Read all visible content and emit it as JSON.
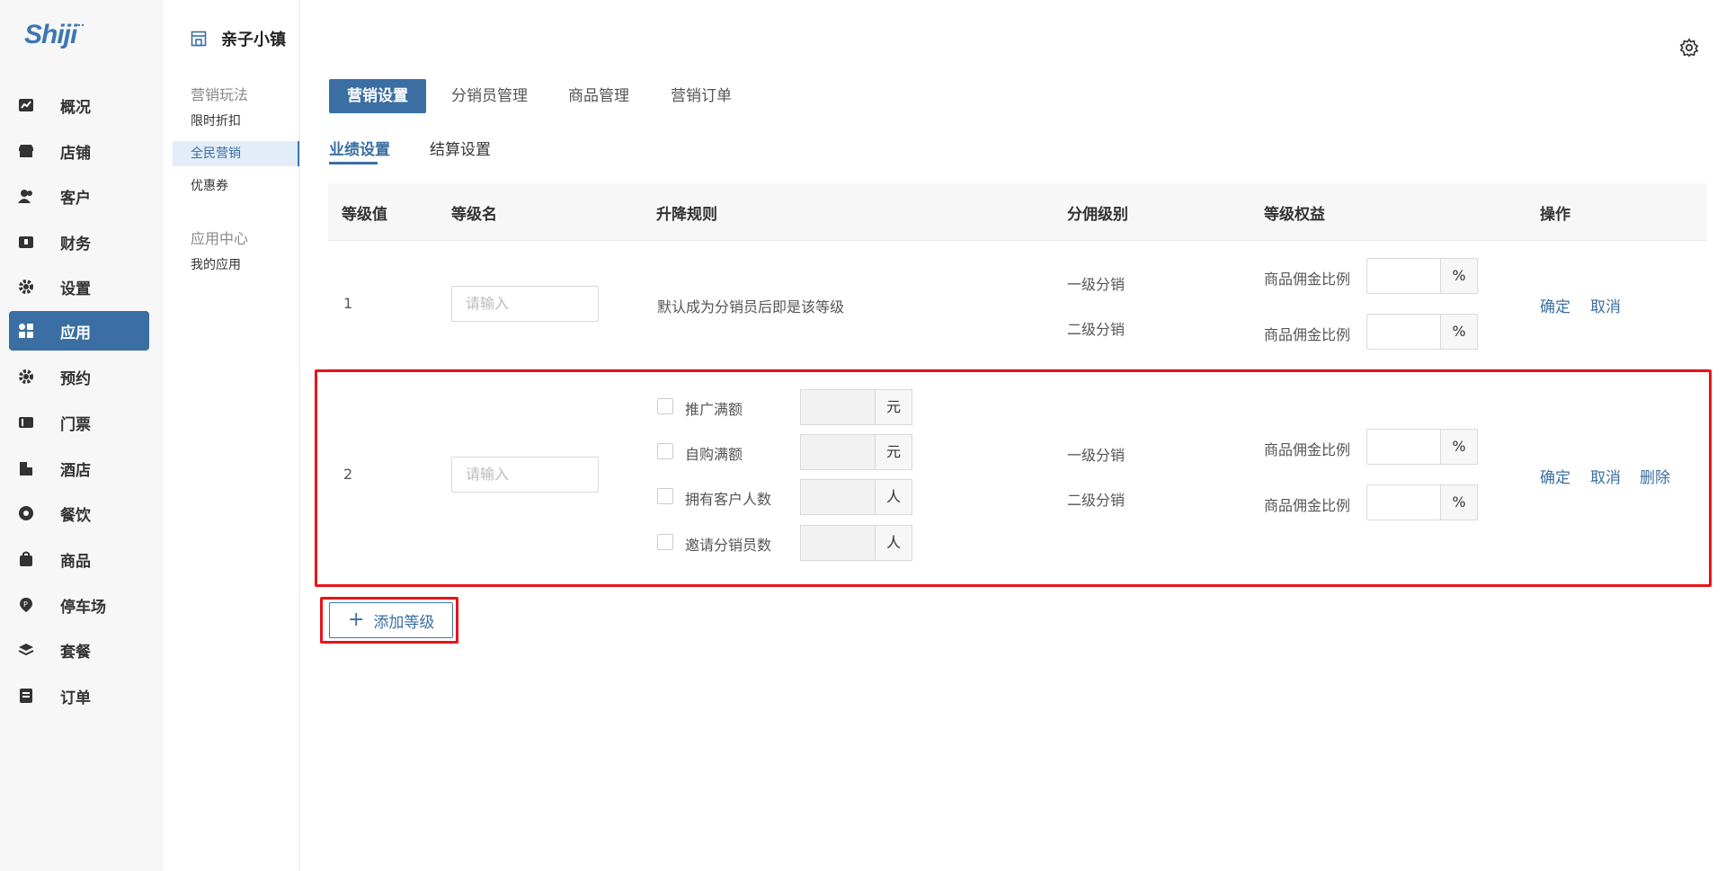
{
  "brand": {
    "logo_text": "Shiji"
  },
  "nav": {
    "items": [
      {
        "label": "概况",
        "icon": "chart-icon"
      },
      {
        "label": "店铺",
        "icon": "store-icon"
      },
      {
        "label": "客户",
        "icon": "users-icon"
      },
      {
        "label": "财务",
        "icon": "wallet-icon"
      },
      {
        "label": "设置",
        "icon": "gear-icon"
      },
      {
        "label": "应用",
        "icon": "apps-icon",
        "active": true
      },
      {
        "label": "预约",
        "icon": "gear-icon"
      },
      {
        "label": "门票",
        "icon": "ticket-icon"
      },
      {
        "label": "酒店",
        "icon": "hotel-icon"
      },
      {
        "label": "餐饮",
        "icon": "dining-icon"
      },
      {
        "label": "商品",
        "icon": "bag-icon"
      },
      {
        "label": "停车场",
        "icon": "parking-icon"
      },
      {
        "label": "套餐",
        "icon": "layers-icon"
      },
      {
        "label": "订单",
        "icon": "order-icon"
      }
    ]
  },
  "header": {
    "store_name": "亲子小镇"
  },
  "subnav": {
    "group1": "营销玩法",
    "items1": [
      "限时折扣",
      "全民营销",
      "优惠券"
    ],
    "group2": "应用中心",
    "items2": [
      "我的应用"
    ]
  },
  "tabs": [
    "营销设置",
    "分销员管理",
    "商品管理",
    "营销订单"
  ],
  "subtabs": [
    "业绩设置",
    "结算设置"
  ],
  "table": {
    "headers": [
      "等级值",
      "等级名",
      "升降规则",
      "分佣级别",
      "等级权益",
      "操作"
    ],
    "placeholder": "请输入",
    "commission_label": "商品佣金比例",
    "percent": "%",
    "row1": {
      "level": "1",
      "rule": "默认成为分销员后即是该等级",
      "tiers": [
        "一级分销",
        "二级分销"
      ],
      "actions": [
        "确定",
        "取消"
      ]
    },
    "row2": {
      "level": "2",
      "conditions": [
        {
          "label": "推广满额",
          "unit": "元"
        },
        {
          "label": "自购满额",
          "unit": "元"
        },
        {
          "label": "拥有客户人数",
          "unit": "人"
        },
        {
          "label": "邀请分销员数",
          "unit": "人"
        }
      ],
      "tiers": [
        "一级分销",
        "二级分销"
      ],
      "actions": [
        "确定",
        "取消",
        "删除"
      ]
    }
  },
  "add_level_button": "添加等级",
  "plus": "+",
  "colors": {
    "primary": "#3b6fa3",
    "highlight": "#e8131b"
  }
}
